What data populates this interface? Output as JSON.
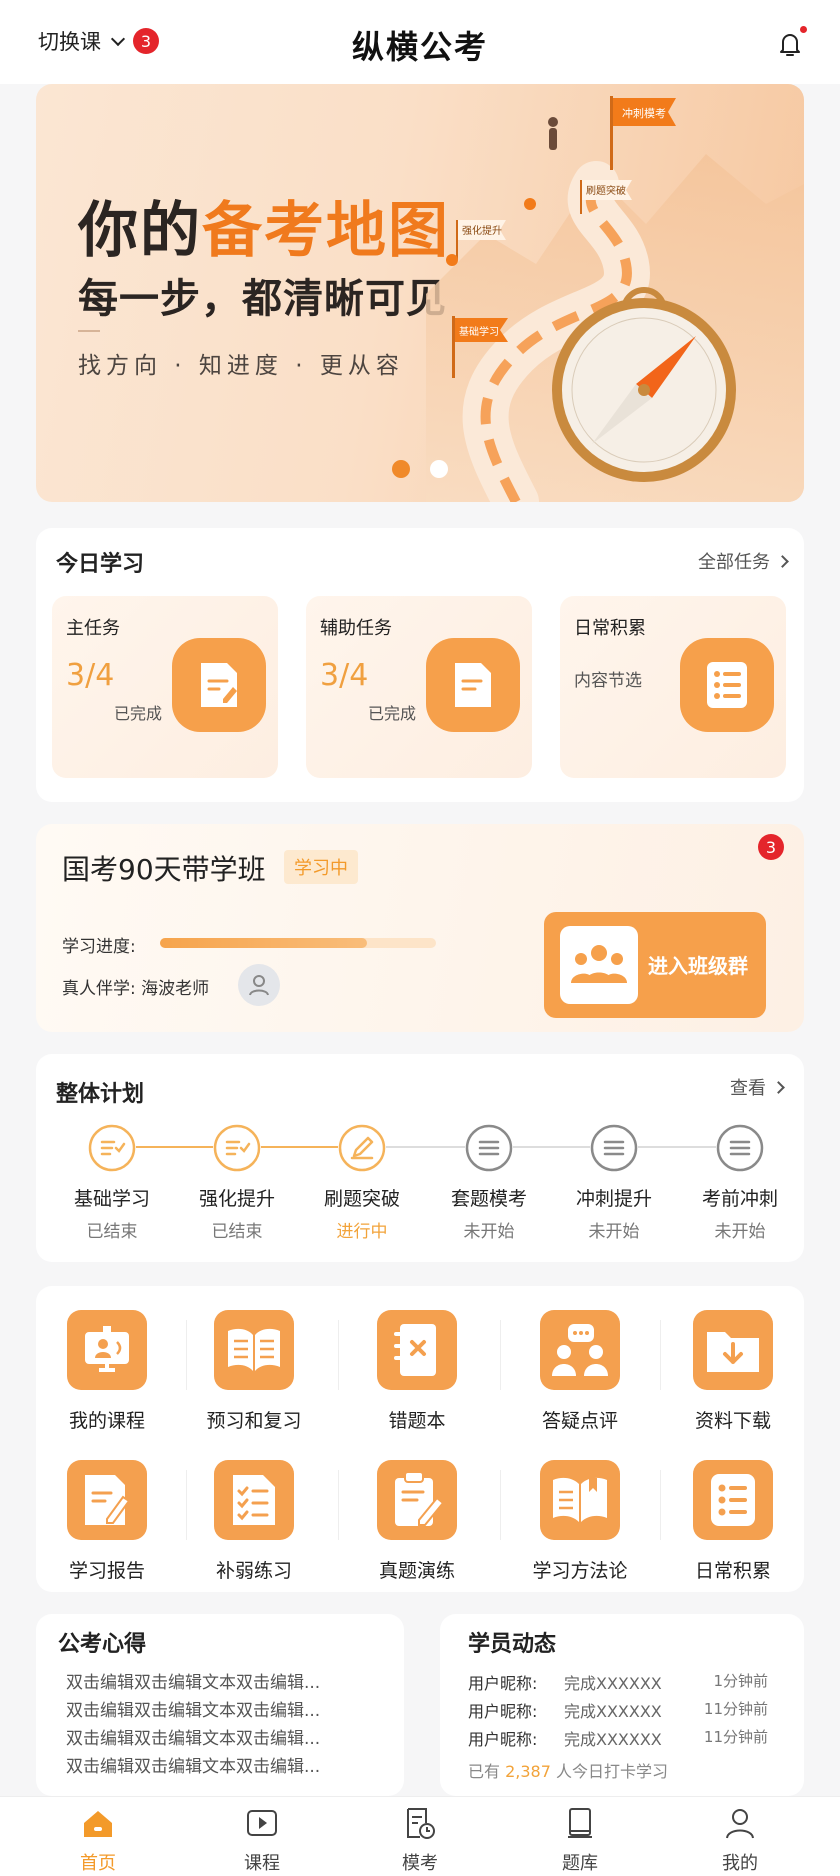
{
  "header": {
    "switch_label": "切换课",
    "switch_badge": "3",
    "title": "纵横公考"
  },
  "banner": {
    "line1_prefix": "你的",
    "line1_highlight": "备考地图",
    "line2": "每一步，都清晰可见",
    "line3": "找方向 · 知进度 · 更从容",
    "flags": [
      "冲刺模考",
      "刷题突破",
      "强化提升",
      "基础学习"
    ],
    "active_slide": 1,
    "slide_count": 2
  },
  "today": {
    "title": "今日学习",
    "more": "全部任务",
    "tasks": [
      {
        "name": "主任务",
        "count": "3/4",
        "status": "已完成",
        "icon": "edit-doc-icon"
      },
      {
        "name": "辅助任务",
        "count": "3/4",
        "status": "已完成",
        "icon": "doc-icon"
      },
      {
        "name": "日常积累",
        "sub": "内容节选",
        "icon": "list-icon"
      }
    ]
  },
  "class": {
    "title": "国考90天带学班",
    "tag": "学习中",
    "badge": "3",
    "progress_label": "学习进度:",
    "progress": 0.75,
    "mentor_label": "真人伴学: 海波老师",
    "group_button": "进入班级群"
  },
  "plan": {
    "title": "整体计划",
    "more": "查看",
    "stages": [
      {
        "name": "基础学习",
        "status": "已结束",
        "state": "done"
      },
      {
        "name": "强化提升",
        "status": "已结束",
        "state": "done"
      },
      {
        "name": "刷题突破",
        "status": "进行中",
        "state": "active"
      },
      {
        "name": "套题模考",
        "status": "未开始",
        "state": "todo"
      },
      {
        "name": "冲刺提升",
        "status": "未开始",
        "state": "todo"
      },
      {
        "name": "考前冲刺",
        "status": "未开始",
        "state": "todo"
      }
    ]
  },
  "tools": [
    {
      "label": "我的课程",
      "icon": "video-course-icon"
    },
    {
      "label": "预习和复习",
      "icon": "open-book-icon"
    },
    {
      "label": "错题本",
      "icon": "wrong-notebook-icon"
    },
    {
      "label": "答疑点评",
      "icon": "qa-chat-icon"
    },
    {
      "label": "资料下载",
      "icon": "folder-download-icon"
    },
    {
      "label": "学习报告",
      "icon": "report-icon"
    },
    {
      "label": "补弱练习",
      "icon": "checklist-icon"
    },
    {
      "label": "真题演练",
      "icon": "clipboard-pen-icon"
    },
    {
      "label": "学习方法论",
      "icon": "method-book-icon"
    },
    {
      "label": "日常积累",
      "icon": "list-icon"
    }
  ],
  "experience": {
    "title": "公考心得",
    "lines": [
      "双击编辑双击编辑文本双击编辑...",
      "双击编辑双击编辑文本双击编辑...",
      "双击编辑双击编辑文本双击编辑...",
      "双击编辑双击编辑文本双击编辑..."
    ]
  },
  "activity": {
    "title": "学员动态",
    "rows": [
      {
        "user": "用户昵称:",
        "content": "完成XXXXXX",
        "time": "1分钟前"
      },
      {
        "user": "用户昵称:",
        "content": "完成XXXXXX",
        "time": "11分钟前"
      },
      {
        "user": "用户昵称:",
        "content": "完成XXXXXX",
        "time": "11分钟前"
      }
    ],
    "footer_prefix": "已有",
    "footer_num": "2,387",
    "footer_suffix": "人今日打卡学习"
  },
  "tabbar": [
    {
      "label": "首页",
      "icon": "home-icon",
      "active": true
    },
    {
      "label": "课程",
      "icon": "play-icon",
      "active": false
    },
    {
      "label": "模考",
      "icon": "exam-clock-icon",
      "active": false
    },
    {
      "label": "题库",
      "icon": "books-icon",
      "active": false
    },
    {
      "label": "我的",
      "icon": "user-icon",
      "active": false
    }
  ],
  "colors": {
    "accent": "#f4a04f",
    "accent_text": "#f39a2a",
    "badge_red": "#e4252b",
    "page_bg": "#f6f6f7"
  }
}
